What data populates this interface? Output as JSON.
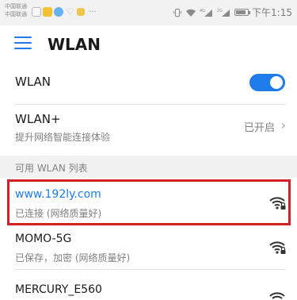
{
  "status_bar": {
    "carrier_1": "中国联通",
    "carrier_2": "中国联通",
    "more": "···",
    "signal_1": "4G",
    "signal_2": "2G",
    "time": "下午1:15",
    "battery_level": 0.85
  },
  "header": {
    "title": "WLAN"
  },
  "wlan_toggle": {
    "label": "WLAN",
    "enabled": true,
    "accent_color": "#1e7ce8"
  },
  "wlan_plus": {
    "title": "WLAN+",
    "subtitle": "提升网络智能连接体验",
    "status": "已开启",
    "chevron": "›"
  },
  "available_section": {
    "header": "可用 WLAN 列表"
  },
  "networks": [
    {
      "name": "www.192ly.com",
      "status": "已连接 (网络质量好)",
      "connected": true,
      "icon": "wifi-lock-icon"
    },
    {
      "name": "MOMO-5G",
      "status": "已保存，加密 (网络质量好)",
      "connected": false,
      "icon": "wifi-lock-icon"
    },
    {
      "name": "MERCURY_E560",
      "status": "",
      "connected": false,
      "icon": "wifi-lock-icon"
    }
  ],
  "colors": {
    "highlight": "#d61f26",
    "connected_text": "#1e7ce8"
  }
}
